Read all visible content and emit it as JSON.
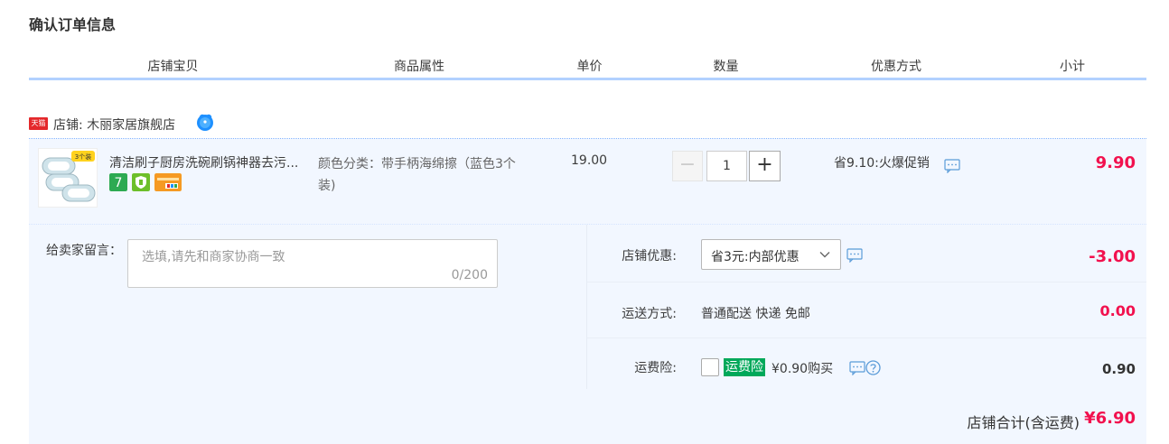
{
  "page": {
    "title": "确认订单信息"
  },
  "columns": [
    "店铺宝贝",
    "商品属性",
    "单价",
    "数量",
    "优惠方式",
    "小计"
  ],
  "shop": {
    "logo_text": "天猫",
    "label": "店铺: 木丽家居旗舰店"
  },
  "item": {
    "title": "清洁刷子厨房洗碗刷锅神器去污...",
    "thumb_tag": "3个装",
    "attribute": "颜色分类：带手柄海绵擦（蓝色3个装)",
    "price": "19.00",
    "quantity": "1",
    "promotion": "省9.10:火爆促销",
    "subtotal": "9.90"
  },
  "message": {
    "label": "给卖家留言：",
    "placeholder": "选填,请先和商家协商一致",
    "count": "0/200"
  },
  "shop_coupon": {
    "label": "店铺优惠:",
    "selected": "省3元:内部优惠",
    "amount": "-3.00"
  },
  "shipping": {
    "label": "运送方式:",
    "value": "普通配送 快递 免邮",
    "amount": "0.00"
  },
  "insurance": {
    "label": "运费险:",
    "tag": "运费险",
    "price_text": "¥0.90购买",
    "amount": "0.90"
  },
  "total": {
    "label": "店铺合计(含运费)",
    "amount": "¥6.90"
  },
  "colors": {
    "accent_red": "#f2114e",
    "header_line": "#b2d1ff",
    "row_bg": "#f2f7ff",
    "insurance_green": "#00a85a",
    "tmall_red": "#e4282b"
  }
}
